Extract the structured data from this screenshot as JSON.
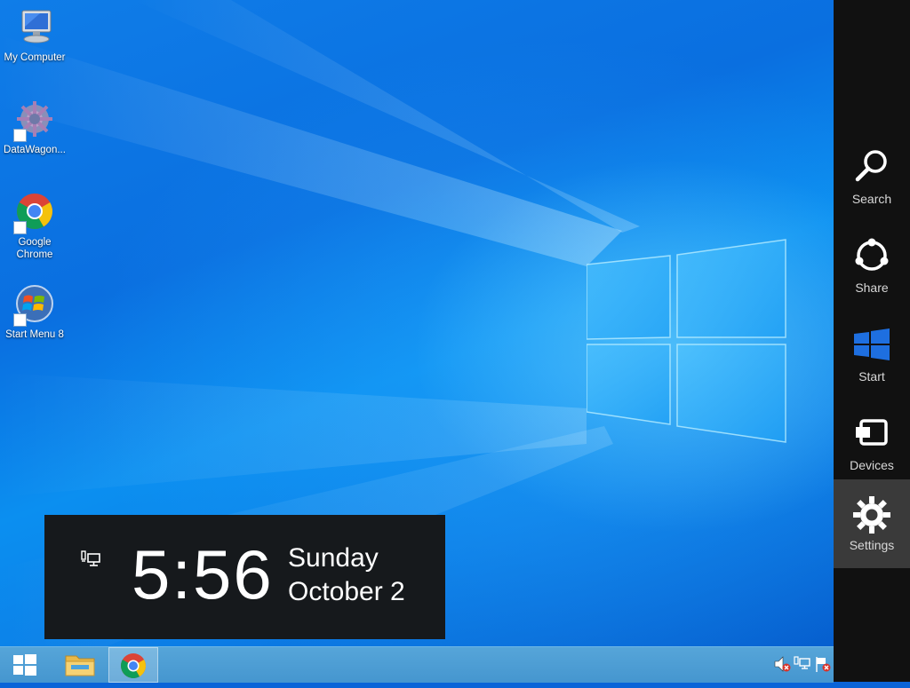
{
  "desktop": {
    "icons": [
      {
        "label": "My Computer",
        "icon": "computer-icon"
      },
      {
        "label": "DataWagon...",
        "icon": "datawagon-icon"
      },
      {
        "label": "Google Chrome",
        "icon": "chrome-icon"
      },
      {
        "label": "Start Menu 8",
        "icon": "windows-orb-icon"
      }
    ]
  },
  "clock": {
    "time": "5:56",
    "day": "Sunday",
    "date": "October 2"
  },
  "charms": {
    "items": [
      {
        "label": "Search",
        "icon": "search-icon"
      },
      {
        "label": "Share",
        "icon": "share-icon"
      },
      {
        "label": "Start",
        "icon": "windows-logo-icon"
      },
      {
        "label": "Devices",
        "icon": "devices-icon"
      },
      {
        "label": "Settings",
        "icon": "gear-icon",
        "selected": true
      }
    ]
  },
  "taskbar": {
    "buttons": [
      "start-button",
      "file-explorer",
      "google-chrome"
    ],
    "active": "google-chrome",
    "tray": [
      "volume-muted-icon",
      "network-icon",
      "action-center-flag-icon"
    ]
  },
  "colors": {
    "charms_bg": "#111111",
    "charm_selected_bg": "#3a3a3a",
    "clock_bg": "#16191c",
    "taskbar": "#4596cf",
    "desktop_blue": "#0a6fe0"
  }
}
